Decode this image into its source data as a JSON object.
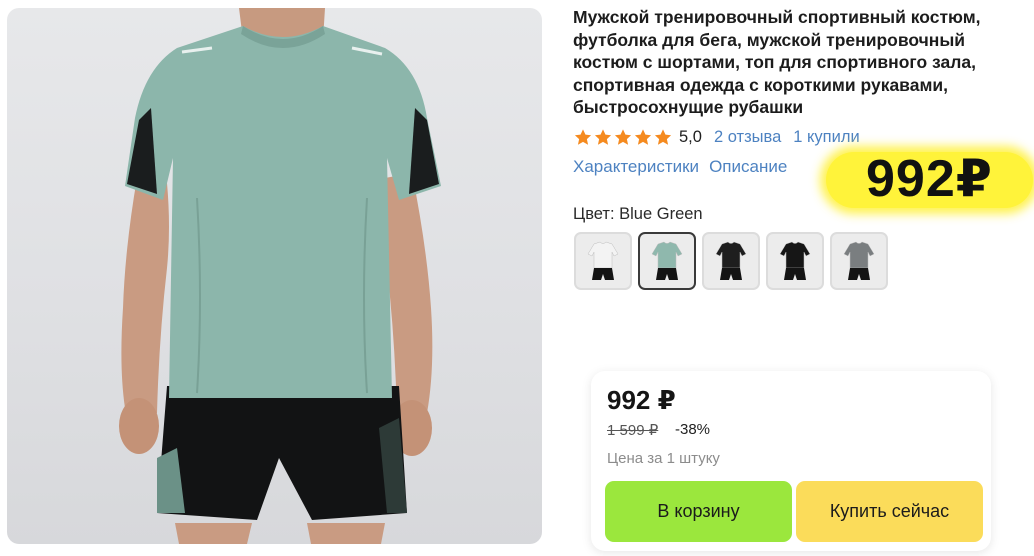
{
  "product": {
    "title": "Мужской тренировочный спортивный костюм, футболка для бега, мужской тренировочный костюм с шортами, топ для спортивного зала, спортивная одежда с короткими рукавами, быстросохнущие рубашки",
    "rating": {
      "stars": 5,
      "value": "5,0",
      "reviews": "2 отзыва",
      "bought": "1 купили",
      "star_color": "#f58a1f"
    },
    "links": {
      "characteristics": "Характеристики",
      "description": "Описание"
    },
    "price_sticker": "992₽",
    "color": {
      "label": "Цвет: Blue Green",
      "selected_index": 1,
      "options": [
        {
          "name": "white",
          "shirt": "#f3f3f3"
        },
        {
          "name": "blue-green",
          "shirt": "#8fb8ad"
        },
        {
          "name": "black",
          "shirt": "#1e1e1e"
        },
        {
          "name": "black-2",
          "shirt": "#161616"
        },
        {
          "name": "grey",
          "shirt": "#7a7e80"
        }
      ]
    }
  },
  "buybox": {
    "price": "992 ₽",
    "old_price": "1 599 ₽",
    "discount": "-38%",
    "per_unit": "Цена за 1 штуку",
    "add_to_cart": "В корзину",
    "buy_now": "Купить сейчас",
    "cart_color": "#9be73d",
    "buy_color": "#fbdc5a"
  },
  "colors": {
    "link": "#4d82c1",
    "sticker": "#fff33a"
  }
}
